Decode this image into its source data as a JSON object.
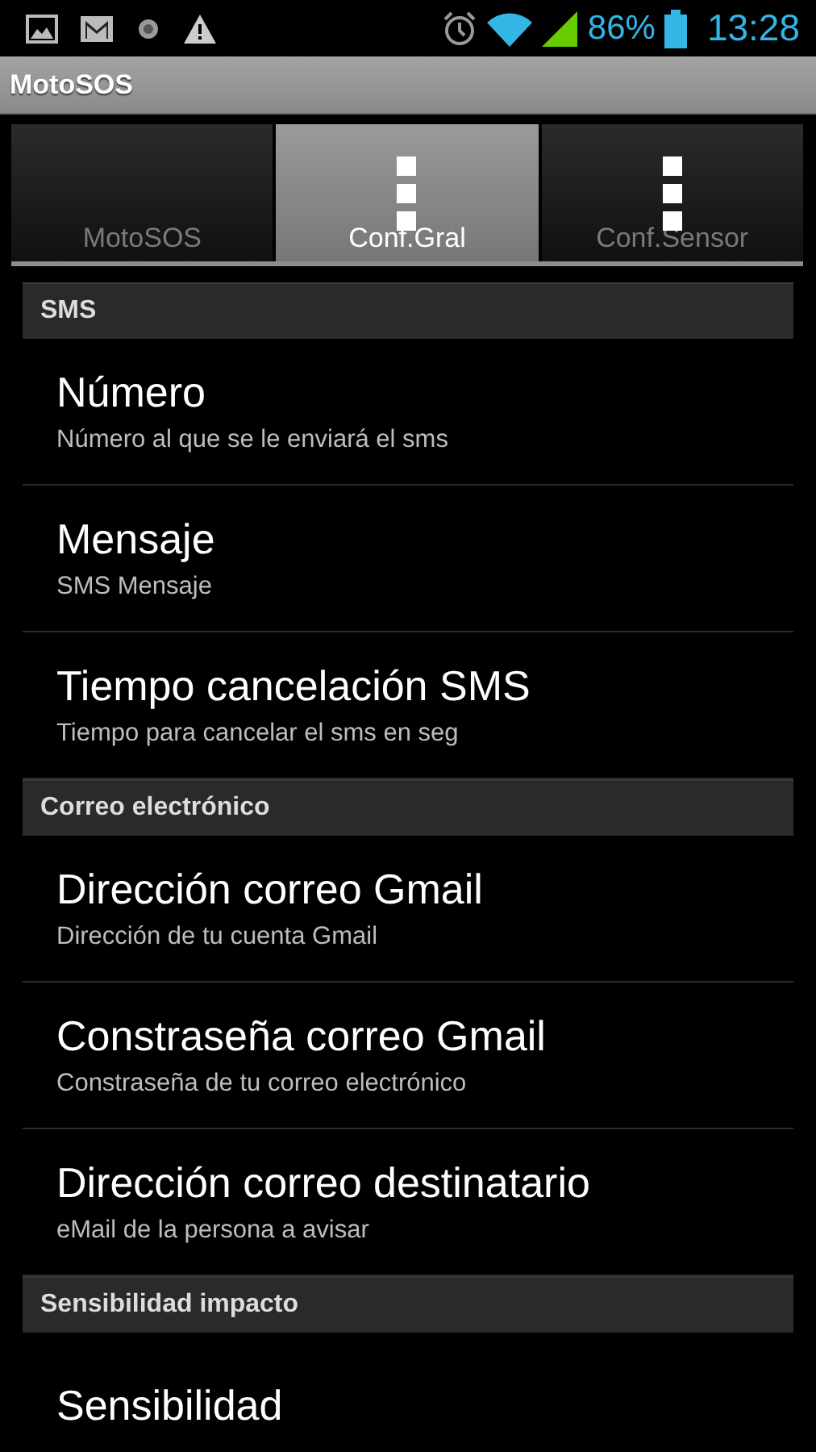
{
  "status_bar": {
    "battery": "86%",
    "time": "13:28"
  },
  "title_bar": {
    "title": "MotoSOS"
  },
  "tabs": [
    {
      "label": "MotoSOS",
      "selected": false,
      "kind": "text"
    },
    {
      "label": "Conf.Gral",
      "selected": true,
      "kind": "icon"
    },
    {
      "label": "Conf.Sensor",
      "selected": false,
      "kind": "icon"
    }
  ],
  "sections": [
    {
      "header": "SMS",
      "items": [
        {
          "title": "Número",
          "summary": "Número al que se le enviará el sms"
        },
        {
          "title": "Mensaje",
          "summary": "SMS Mensaje"
        },
        {
          "title": "Tiempo cancelación SMS",
          "summary": "Tiempo para cancelar el sms en seg"
        }
      ]
    },
    {
      "header": "Correo electrónico",
      "items": [
        {
          "title": "Dirección correo Gmail",
          "summary": "Dirección de tu cuenta Gmail"
        },
        {
          "title": "Constraseña correo Gmail",
          "summary": "Constraseña de tu correo electrónico"
        },
        {
          "title": "Dirección correo destinatario",
          "summary": "eMail de la persona a avisar"
        }
      ]
    },
    {
      "header": "Sensibilidad impacto",
      "items": [
        {
          "title": "Sensibilidad"
        }
      ]
    }
  ]
}
